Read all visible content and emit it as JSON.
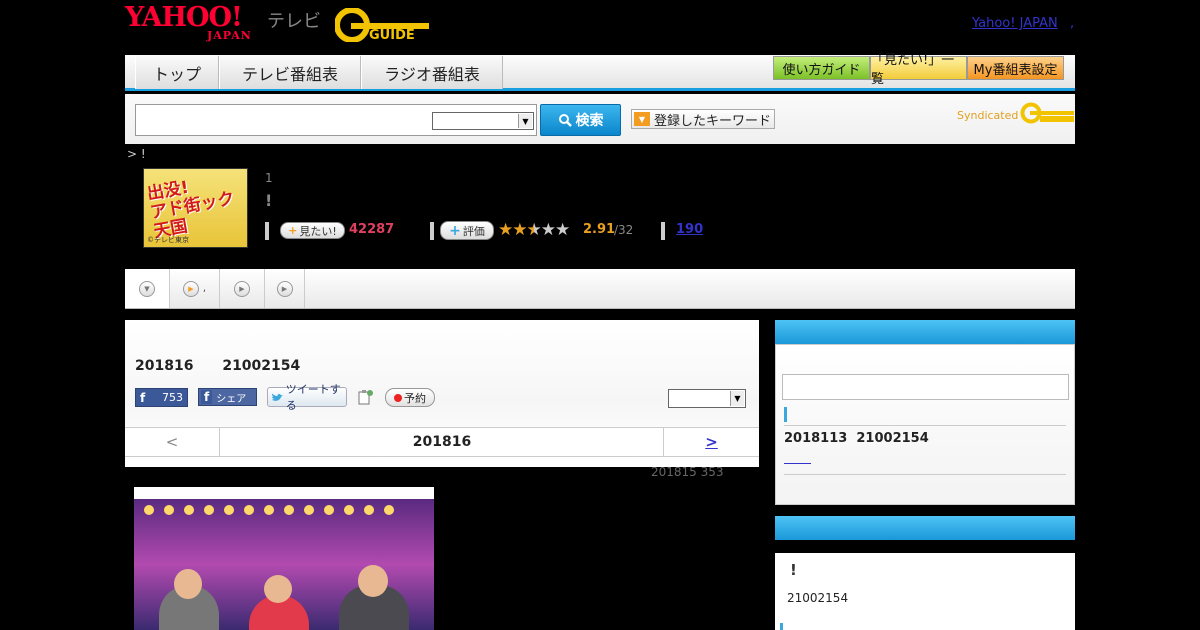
{
  "header": {
    "logo_text": "YAHOO!",
    "logo_sub": "JAPAN",
    "tv_text": "テレビ",
    "gguide_text": "GUIDE",
    "yahoo_japan_link": "Yahoo! JAPAN",
    "link_sep": ","
  },
  "nav": {
    "tabs": [
      {
        "label": "トップ"
      },
      {
        "label": "テレビ番組表"
      },
      {
        "label": "ラジオ番組表"
      }
    ],
    "right_buttons": [
      {
        "label": "使い方ガイド",
        "color": "#8fd13a"
      },
      {
        "label": "「見たい!」一覧",
        "color": "#f5d24a"
      },
      {
        "label": "My番組表設定",
        "color": "#f59c2a"
      }
    ]
  },
  "search": {
    "input_value": "",
    "select_value": "",
    "button_label": "検索",
    "keyword_button_label": "登録したキーワード",
    "syndicated_label": "Syndicated"
  },
  "breadcrumb": "> !",
  "program": {
    "episode": "1",
    "title": "!",
    "thumb_title_line1": "出没!",
    "thumb_title_line2": "アド街ック天国",
    "thumb_credit": "©テレビ東京",
    "mitai_label": "見たい!",
    "mitai_count": "42287",
    "hyoka_label": "評価",
    "stars_filled": 2.5,
    "rating": "2.91",
    "rating_total": "/32",
    "review_count": "190"
  },
  "main": {
    "date": "201816",
    "code": "21002154",
    "fb_like_count": "753",
    "fb_share_label": "シェア",
    "tweet_label": "ツイートする",
    "yoyaku_label": "予約",
    "pager_prev": "<",
    "pager_date": "201816",
    "pager_next": ">",
    "prev_info": "201815  353"
  },
  "side": {
    "box1_date": "2018113",
    "box1_code": "21002154",
    "box2_title": "!",
    "box2_code": "21002154"
  },
  "colors": {
    "accent_blue": "#1aa0e0",
    "link_blue": "#3333cc",
    "mitai_pink": "#e04060",
    "rating_orange": "#e8a020"
  }
}
